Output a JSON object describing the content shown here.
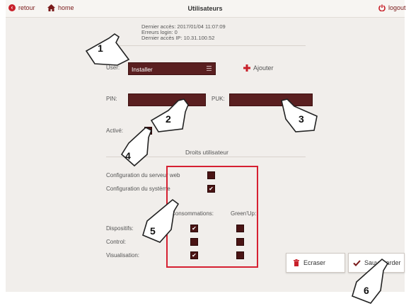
{
  "header": {
    "back_label": "retour",
    "home_label": "home",
    "title": "Utilisateurs",
    "logout_label": "logout"
  },
  "info": {
    "last_access": "Dernier accès: 2017/01/04 11:07:09",
    "login_errors": "Erreurs login: 0",
    "last_ip": "Dernier accès IP: 10.31.100.52"
  },
  "form": {
    "user_label": "User:",
    "user_value": "Installer",
    "add_label": "Ajouter",
    "pin_label": "PIN:",
    "puk_label": "PUK:",
    "active_label": "Activé:"
  },
  "rights": {
    "section_title": "Droits utilisateur",
    "web_config": "Configuration du serveur web",
    "sys_config": "Configuration du système",
    "col_consumption": "Consommations:",
    "col_greenup": "Green'Up:",
    "rows": [
      "Dispositifs:",
      "Control:",
      "Visualisation:"
    ]
  },
  "buttons": {
    "erase": "Ecraser",
    "save": "Sauvegarder"
  },
  "callouts": [
    "1",
    "2",
    "3",
    "4",
    "5",
    "6"
  ],
  "colors": {
    "accent_red": "#d62031",
    "field_dark": "#5a1f20"
  }
}
